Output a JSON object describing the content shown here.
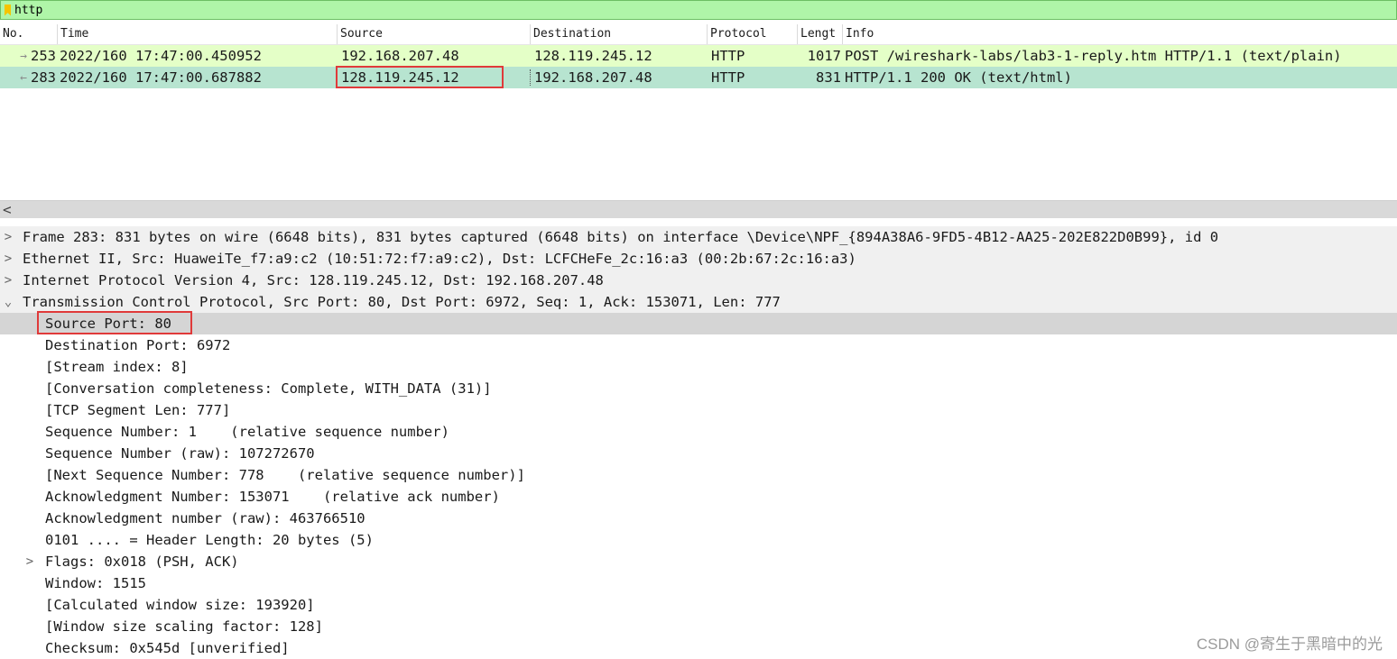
{
  "filter": {
    "value": "http"
  },
  "packet_list": {
    "columns": [
      "No.",
      "Time",
      "Source",
      "Destination",
      "Protocol",
      "Lengt",
      "Info"
    ],
    "rows": [
      {
        "no": "253",
        "time": "2022/160 17:47:00.450952",
        "source": "192.168.207.48",
        "destination": "128.119.245.12",
        "protocol": "HTTP",
        "length": "1017",
        "info": "POST /wireshark-labs/lab3-1-reply.htm HTTP/1.1  (text/plain)",
        "direction": "→"
      },
      {
        "no": "283",
        "time": "2022/160 17:47:00.687882",
        "source": "128.119.245.12",
        "destination": "192.168.207.48",
        "protocol": "HTTP",
        "length": "831",
        "info": "HTTP/1.1 200 OK  (text/html)",
        "direction": "←"
      }
    ]
  },
  "scroll": {
    "left_arrow": "<"
  },
  "detail": {
    "top_level": [
      {
        "expander": ">",
        "text": "Frame 283: 831 bytes on wire (6648 bits), 831 bytes captured (6648 bits) on interface \\Device\\NPF_{894A38A6-9FD5-4B12-AA25-202E822D0B99}, id 0"
      },
      {
        "expander": ">",
        "text": "Ethernet II, Src: HuaweiTe_f7:a9:c2 (10:51:72:f7:a9:c2), Dst: LCFCHeFe_2c:16:a3 (00:2b:67:2c:16:a3)"
      },
      {
        "expander": ">",
        "text": "Internet Protocol Version 4, Src: 128.119.245.12, Dst: 192.168.207.48"
      },
      {
        "expander": "⌄",
        "text": "Transmission Control Protocol, Src Port: 80, Dst Port: 6972, Seq: 1, Ack: 153071, Len: 777"
      }
    ],
    "tcp_fields": [
      {
        "text": "Source Port: 80"
      },
      {
        "text": "Destination Port: 6972"
      },
      {
        "text": "[Stream index: 8]"
      },
      {
        "text": "[Conversation completeness: Complete, WITH_DATA (31)]"
      },
      {
        "text": "[TCP Segment Len: 777]"
      },
      {
        "text": "Sequence Number: 1    (relative sequence number)"
      },
      {
        "text": "Sequence Number (raw): 107272670"
      },
      {
        "text": "[Next Sequence Number: 778    (relative sequence number)]"
      },
      {
        "text": "Acknowledgment Number: 153071    (relative ack number)"
      },
      {
        "text": "Acknowledgment number (raw): 463766510"
      },
      {
        "text": "0101 .... = Header Length: 20 bytes (5)"
      },
      {
        "text": "Flags: 0x018 (PSH, ACK)",
        "expander": ">"
      },
      {
        "text": "Window: 1515"
      },
      {
        "text": "[Calculated window size: 193920]"
      },
      {
        "text": "[Window size scaling factor: 128]"
      },
      {
        "text": "Checksum: 0x545d [unverified]"
      }
    ]
  },
  "watermark": "CSDN @寄生于黑暗中的光",
  "colors": {
    "filter_bg": "#aff5a8",
    "row_request": "#e4ffc7",
    "row_response": "#b7e4d0",
    "highlight": "#e03a3a"
  }
}
